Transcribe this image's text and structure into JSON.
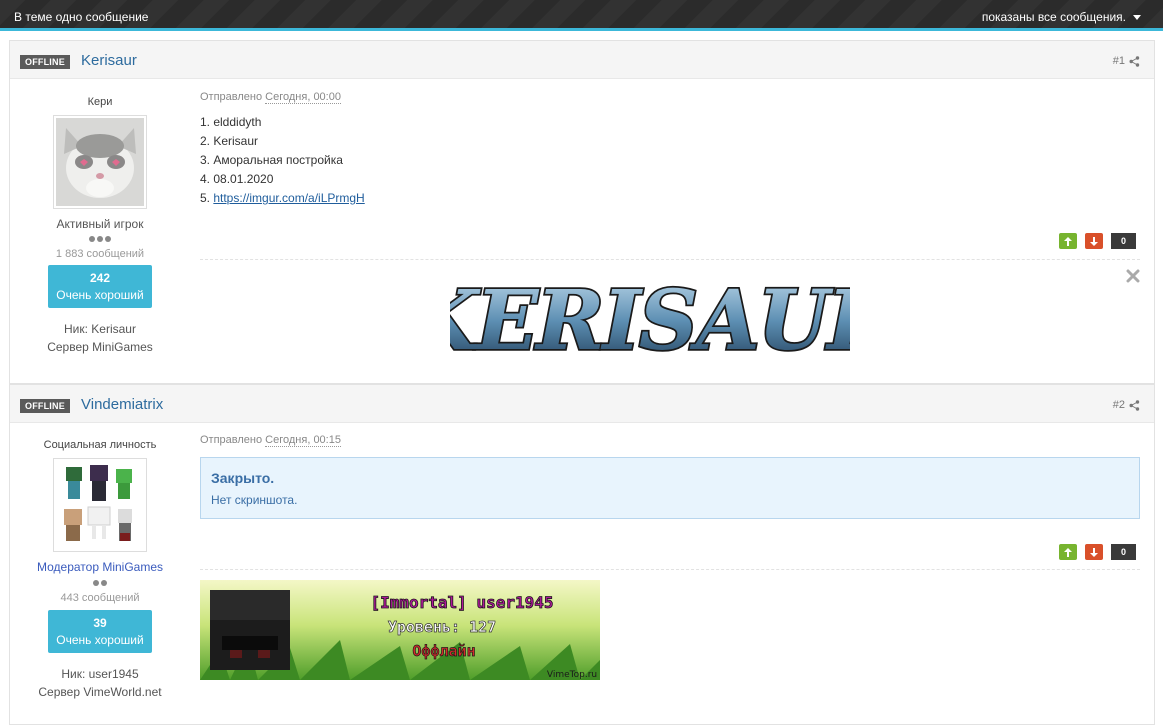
{
  "topbar": {
    "left_text": "В теме одно сообщение",
    "right_text": "показаны все сообщения."
  },
  "posts": [
    {
      "status": "OFFLINE",
      "author": "Kerisaur",
      "number": "#1",
      "user_title": "Кери",
      "group": "Активный игрок",
      "posts_count": "1 883 сообщений",
      "rep_value": "242",
      "rep_label": "Очень хороший",
      "nick": "Ник: Kerisaur",
      "server": "Сервер MiniGames",
      "sent_label": "Отправлено",
      "sent_date": "Сегодня, 00:00",
      "lines": [
        "1. elddidyth",
        "2. Kerisaur",
        "3. Аморальная постройка",
        "4. 08.01.2020",
        "5. "
      ],
      "link": "https://imgur.com/a/iLPrmgH",
      "votes": "0",
      "signature_text": "KERISAUR"
    },
    {
      "status": "OFFLINE",
      "author": "Vindemiatrix",
      "number": "#2",
      "user_title": "Социальная личность",
      "group": "Модератор MiniGames",
      "posts_count": "443 сообщений",
      "rep_value": "39",
      "rep_label": "Очень хороший",
      "nick": "Ник: user1945",
      "server": "Сервер VimeWorld.net",
      "sent_label": "Отправлено",
      "sent_date": "Сегодня, 00:15",
      "closed_title": "Закрыто.",
      "closed_sub": "Нет скриншота.",
      "votes": "0",
      "banner": {
        "line1": "[Immortal] user1945",
        "line2": "Уровень: 127",
        "line3": "Оффлайн",
        "footer": "VimeTop.ru"
      }
    }
  ],
  "colors": {
    "accent": "#3cb8d9",
    "up": "#77b42f",
    "down": "#d9502a"
  }
}
